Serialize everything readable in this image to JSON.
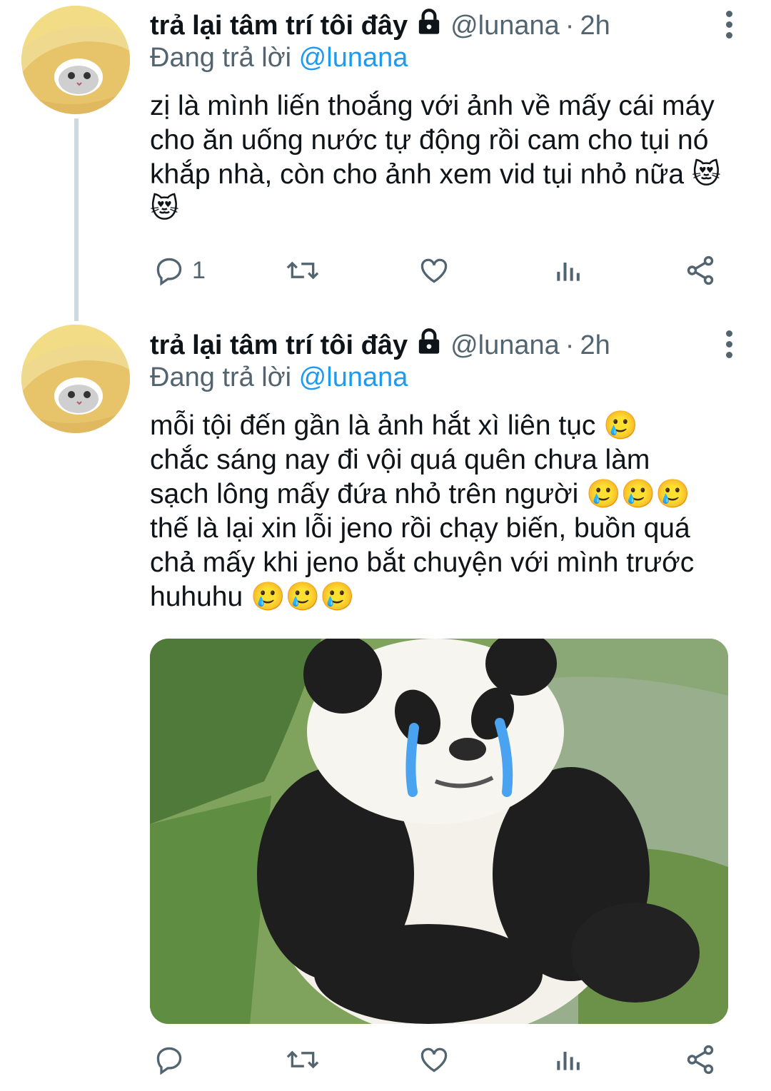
{
  "tweets": [
    {
      "display_name": "trả lại tâm trí tôi đây",
      "handle": "@lunana",
      "separator": "·",
      "time": "2h",
      "replying_prefix": "Đang trả lời",
      "replying_to": "@lunana",
      "text": "zị là mình liến thoắng với ảnh về mấy cái máy cho ăn uống nước tự động rồi cam cho tụi nó khắp nhà, còn cho ảnh xem vid tụi nhỏ nữa 😻😻",
      "reply_count": "1",
      "icons": [
        "lock-icon",
        "more-icon",
        "reply-icon",
        "retweet-icon",
        "like-icon",
        "analytics-icon",
        "share-icon"
      ]
    },
    {
      "display_name": "trả lại tâm trí tôi đây",
      "handle": "@lunana",
      "separator": "·",
      "time": "2h",
      "replying_prefix": "Đang trả lời",
      "replying_to": "@lunana",
      "text_lines": [
        "mỗi tội đến gần là ảnh hắt xì liên tục 🥲",
        "chắc sáng nay đi vội quá quên chưa làm",
        "sạch lông mấy đứa nhỏ trên người 🥲🥲🥲",
        "thế là lại xin lỗi jeno rồi chạy biến, buồn quá",
        "chả mấy khi jeno bắt chuyện với mình trước",
        "huhuhu 🥲🥲🥲"
      ],
      "reply_count": "",
      "icons": [
        "lock-icon",
        "more-icon",
        "reply-icon",
        "retweet-icon",
        "like-icon",
        "analytics-icon",
        "share-icon"
      ]
    }
  ],
  "colors": {
    "text": "#0f1419",
    "secondary": "#536471",
    "link": "#1d9bf0",
    "thread_line": "#cfd9de"
  }
}
